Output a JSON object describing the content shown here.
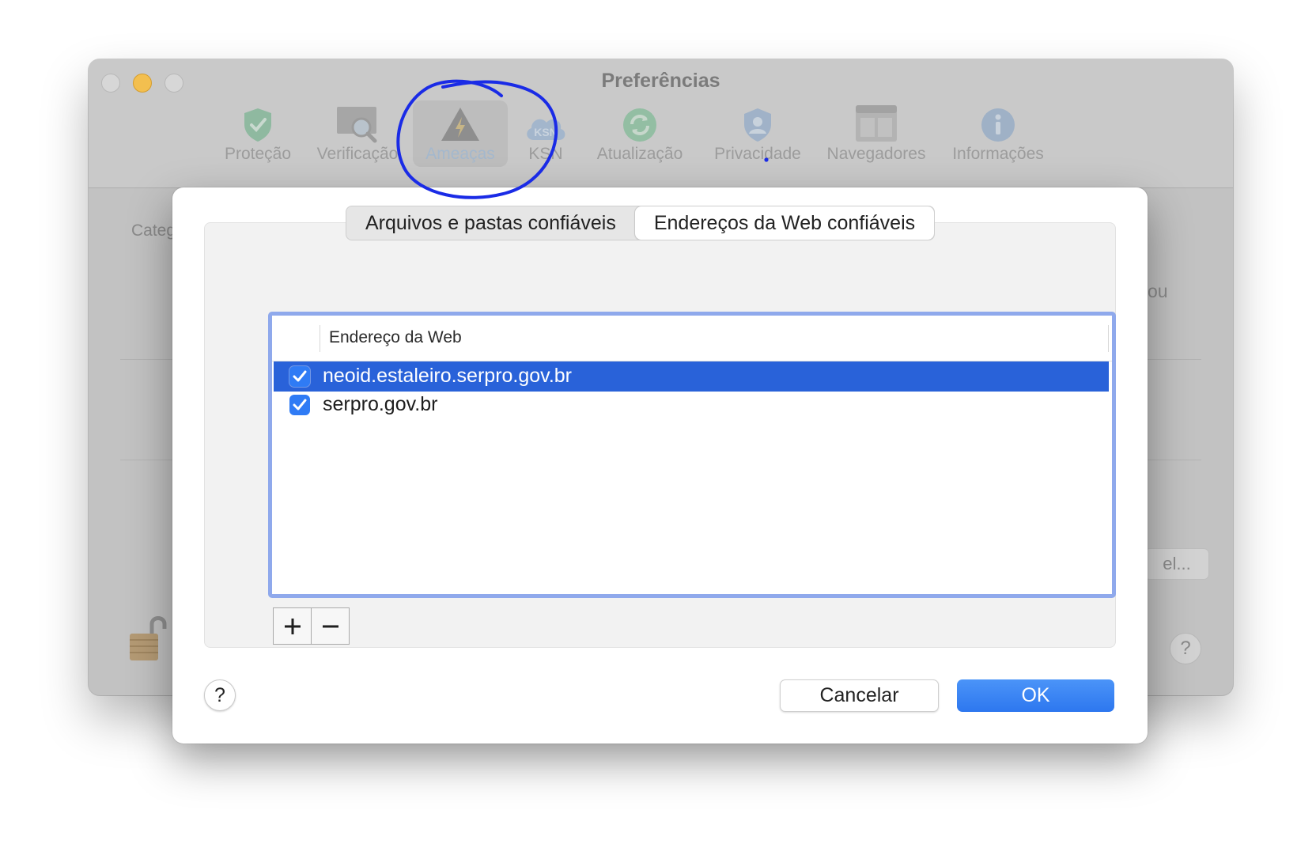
{
  "window": {
    "title": "Preferências",
    "toolbar": [
      {
        "label": "Proteção",
        "icon": "shield-check-icon"
      },
      {
        "label": "Verificação",
        "icon": "scan-magnifier-icon"
      },
      {
        "label": "Ameaças",
        "icon": "threat-warning-icon",
        "selected": true
      },
      {
        "label": "KSN",
        "icon": "ksn-cloud-icon"
      },
      {
        "label": "Atualização",
        "icon": "update-sync-icon"
      },
      {
        "label": "Privacidade",
        "icon": "privacy-user-shield-icon"
      },
      {
        "label": "Navegadores",
        "icon": "browser-window-icon"
      },
      {
        "label": "Informações",
        "icon": "info-icon"
      }
    ],
    "background_text": {
      "category_partial": "Categ",
      "right_partial": "ou",
      "button_partial": "el...",
      "help": "?"
    }
  },
  "dialog": {
    "tabs": [
      {
        "label": "Arquivos e pastas confiáveis",
        "active": false
      },
      {
        "label": "Endereços da Web confiáveis",
        "active": true
      }
    ],
    "list": {
      "column_header": "Endereço da Web",
      "rows": [
        {
          "address": "neoid.estaleiro.serpro.gov.br",
          "checked": true,
          "selected": true
        },
        {
          "address": "serpro.gov.br",
          "checked": true,
          "selected": false
        }
      ]
    },
    "add_label": "+",
    "remove_label": "−",
    "help_label": "?",
    "cancel_label": "Cancelar",
    "ok_label": "OK"
  },
  "colors": {
    "accent": "#2f7bf5",
    "selection": "#2962d9",
    "annotation_ink": "#1a2be6"
  }
}
